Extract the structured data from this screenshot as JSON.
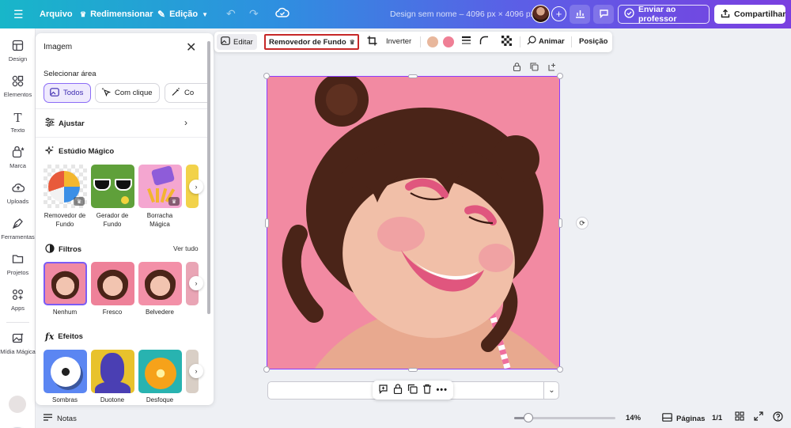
{
  "topbar": {
    "file_label": "Arquivo",
    "resize_label": "Redimensionar",
    "edit_label": "Edição",
    "doc_title": "Design sem nome – 4096 px × 4096 px",
    "plus_symbol": "+",
    "send_label": "Enviar ao professor",
    "share_label": "Compartilhar"
  },
  "rail": {
    "items": [
      {
        "label": "Design",
        "icon": "layout-icon"
      },
      {
        "label": "Elementos",
        "icon": "shapes-icon"
      },
      {
        "label": "Texto",
        "icon": "text-icon"
      },
      {
        "label": "Marca",
        "icon": "brand-icon"
      },
      {
        "label": "Uploads",
        "icon": "upload-cloud-icon"
      },
      {
        "label": "Ferramentas",
        "icon": "pen-tool-icon"
      },
      {
        "label": "Projetos",
        "icon": "folder-icon"
      },
      {
        "label": "Apps",
        "icon": "apps-grid-icon"
      },
      {
        "label": "Mídia Mágica",
        "icon": "magic-media-icon"
      }
    ]
  },
  "panel": {
    "title": "Imagem",
    "select_area": "Selecionar área",
    "chips": [
      {
        "label": "Todos"
      },
      {
        "label": "Com clique"
      },
      {
        "label": "Co"
      }
    ],
    "adjust": "Ajustar",
    "magic_studio": {
      "title": "Estúdio Mágico",
      "items": [
        {
          "label": "Removedor de Fundo"
        },
        {
          "label": "Gerador de Fundo"
        },
        {
          "label": "Borracha Mágica"
        }
      ]
    },
    "filters": {
      "title": "Filtros",
      "see_all": "Ver tudo",
      "items": [
        {
          "label": "Nenhum"
        },
        {
          "label": "Fresco"
        },
        {
          "label": "Belvedere"
        }
      ]
    },
    "effects": {
      "title": "Efeitos",
      "items": [
        {
          "label": "Sombras"
        },
        {
          "label": "Duotone"
        },
        {
          "label": "Desfoque"
        }
      ]
    }
  },
  "context_toolbar": {
    "edit": "Editar",
    "bg_remover": "Removedor de Fundo",
    "flip": "Inverter",
    "swatches": [
      "#e8b79c",
      "#ef7f95"
    ],
    "animate": "Animar",
    "position": "Posição"
  },
  "bottombar": {
    "notes": "Notas",
    "zoom": "14%",
    "zoom_level": 0.14,
    "pages": "Páginas",
    "page_count": "1/1"
  },
  "colors": {
    "accent": "#8b3dff",
    "photo_bg": "#f28aa2",
    "highlight": "#c62828"
  }
}
